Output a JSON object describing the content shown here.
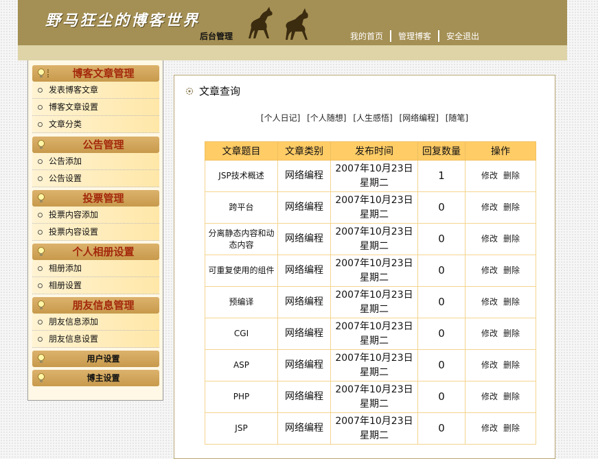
{
  "header": {
    "brand": "野马狂尘的博客世界",
    "subtitle": "后台管理",
    "nav": [
      "我的首页",
      "管理博客",
      "安全退出"
    ]
  },
  "sidebar": {
    "groups": [
      {
        "title": "博客文章管理",
        "items": [
          "发表博客文章",
          "博客文章设置",
          "文章分类"
        ]
      },
      {
        "title": "公告管理",
        "items": [
          "公告添加",
          "公告设置"
        ]
      },
      {
        "title": "投票管理",
        "items": [
          "投票内容添加",
          "投票内容设置"
        ]
      },
      {
        "title": "个人相册设置",
        "items": [
          "相册添加",
          "相册设置"
        ]
      },
      {
        "title": "朋友信息管理",
        "items": [
          "朋友信息添加",
          "朋友信息设置"
        ]
      },
      {
        "title": "用户设置",
        "items": []
      },
      {
        "title": "博主设置",
        "items": []
      }
    ]
  },
  "main": {
    "title": "文章查询",
    "filters": [
      "[个人日记]",
      "[个人随想]",
      "[人生感悟]",
      "[网络编程]",
      "[随笔]"
    ],
    "columns": [
      "文章题目",
      "文章类别",
      "发布时间",
      "回复数量",
      "操作"
    ],
    "edit_label": "修改",
    "delete_label": "删除",
    "rows": [
      {
        "title": "JSP技术概述",
        "category": "网络编程",
        "date": "2007年10月23日 星期二",
        "replies": "1"
      },
      {
        "title": "跨平台",
        "category": "网络编程",
        "date": "2007年10月23日 星期二",
        "replies": "0"
      },
      {
        "title": "分离静态内容和动态内容",
        "category": "网络编程",
        "date": "2007年10月23日 星期二",
        "replies": "0"
      },
      {
        "title": "可重复使用的组件",
        "category": "网络编程",
        "date": "2007年10月23日 星期二",
        "replies": "0"
      },
      {
        "title": "预编译",
        "category": "网络编程",
        "date": "2007年10月23日 星期二",
        "replies": "0"
      },
      {
        "title": "CGI",
        "category": "网络编程",
        "date": "2007年10月23日 星期二",
        "replies": "0"
      },
      {
        "title": "ASP",
        "category": "网络编程",
        "date": "2007年10月23日 星期二",
        "replies": "0"
      },
      {
        "title": "PHP",
        "category": "网络编程",
        "date": "2007年10月23日 星期二",
        "replies": "0"
      },
      {
        "title": "JSP",
        "category": "网络编程",
        "date": "2007年10月23日 星期二",
        "replies": "0"
      }
    ]
  },
  "colors": {
    "header_bg": "#a48f54",
    "strip_bg": "#ded4a8",
    "table_header_bg": "#ffcc66",
    "category_title": "#a3280c"
  },
  "icons": {
    "horses": "horse-silhouette-icon",
    "bulb": "lightbulb-icon",
    "ring": "ring-bullet-icon",
    "gear": "gear-icon"
  }
}
